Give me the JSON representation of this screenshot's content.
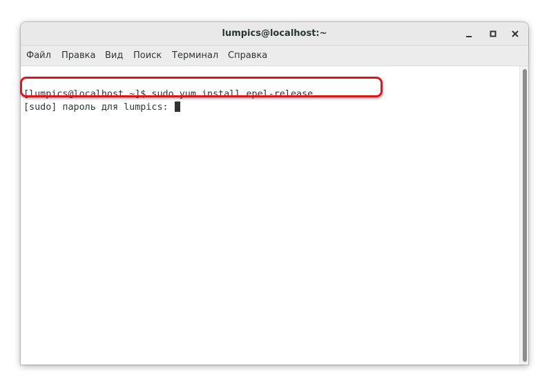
{
  "window": {
    "title": "lumpics@localhost:~"
  },
  "menu": {
    "items": [
      "Файл",
      "Правка",
      "Вид",
      "Поиск",
      "Терминал",
      "Справка"
    ]
  },
  "terminal": {
    "lines": [
      "[lumpics@localhost ~]$ sudo yum install epel-release",
      "[sudo] пароль для lumpics: "
    ]
  },
  "icons": {
    "minimize": "minimize-icon",
    "maximize": "maximize-icon",
    "close": "close-icon"
  },
  "colors": {
    "highlight": "#e0141e",
    "text": "#2e3436",
    "titlebar": "#e9e9e9"
  }
}
